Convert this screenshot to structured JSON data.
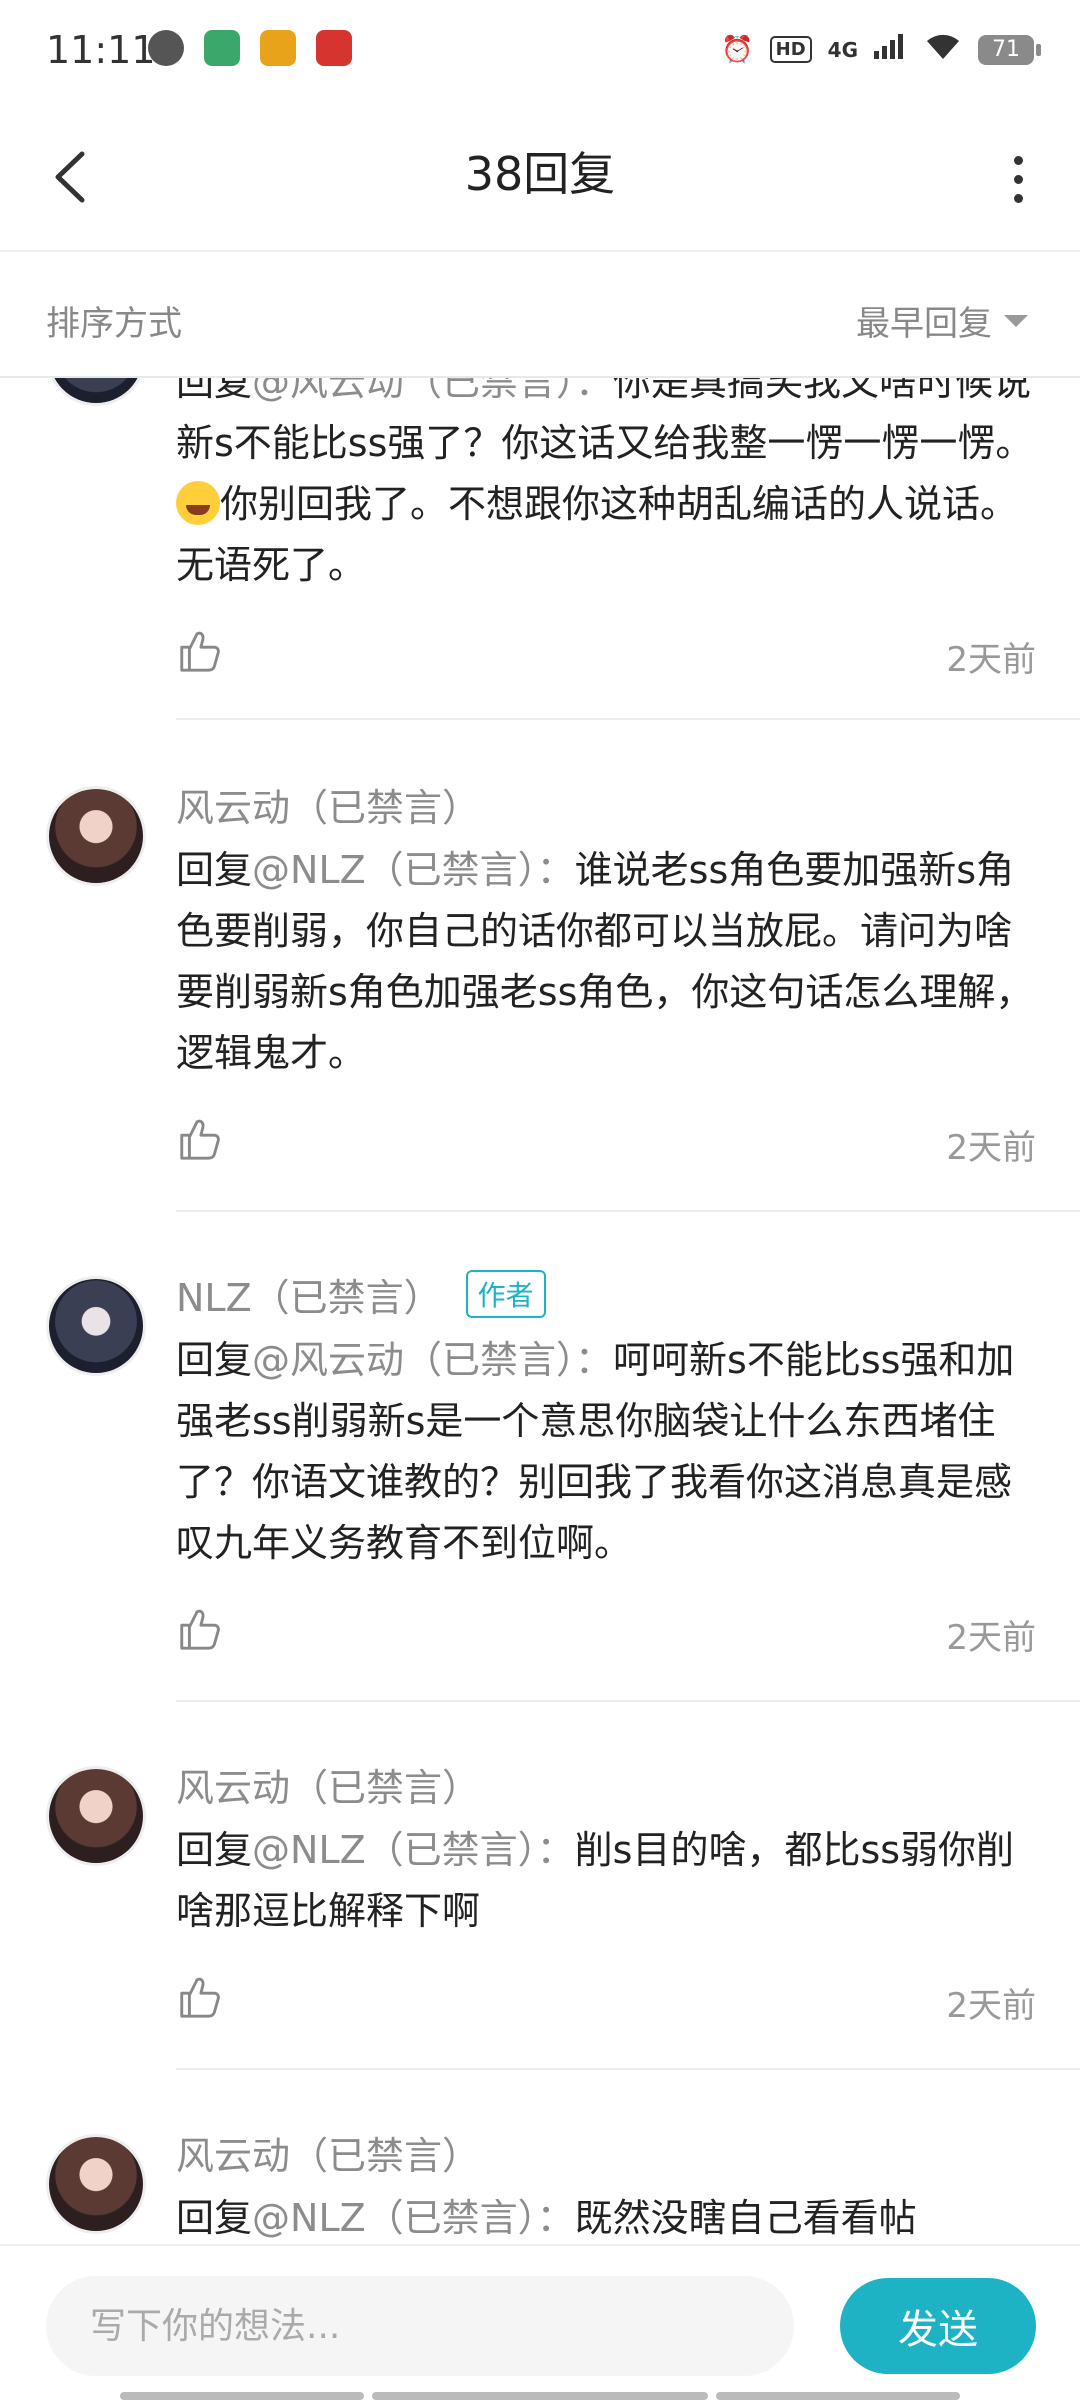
{
  "status_bar": {
    "time": "11:11",
    "network": "4G",
    "hd": "HD",
    "battery": "71"
  },
  "header": {
    "title": "38回复"
  },
  "sort": {
    "label": "排序方式",
    "value": "最早回复"
  },
  "replies": [
    {
      "name": "",
      "is_author": true,
      "at": "@风云动（已禁言）：",
      "prefix": "回复",
      "text": "你是真搞笑我又啥时候说新s不能比ss强了？你这话又给我整一愣一愣一愣。",
      "text_after_emoji": "你别回我了。不想跟你这种胡乱编话的人说话。无语死了。",
      "emoji": "laughing-tears",
      "time": "2天前"
    },
    {
      "name": "风云动（已禁言）",
      "is_author": false,
      "prefix": "回复",
      "at": "@NLZ（已禁言）：",
      "text": "谁说老ss角色要加强新s角色要削弱，你自己的话你都可以当放屁。请问为啥要削弱新s角色加强老ss角色，你这句话怎么理解，逻辑鬼才。",
      "time": "2天前"
    },
    {
      "name": "NLZ（已禁言）",
      "is_author": true,
      "author_tag": "作者",
      "prefix": "回复",
      "at": "@风云动（已禁言）：",
      "text": "呵呵新s不能比ss强和加强老ss削弱新s是一个意思你脑袋让什么东西堵住了？你语文谁教的？别回我了我看你这消息真是感叹九年义务教育不到位啊。",
      "time": "2天前"
    },
    {
      "name": "风云动（已禁言）",
      "is_author": false,
      "prefix": "回复",
      "at": "@NLZ（已禁言）：",
      "text": "削s目的啥，都比ss弱你削啥那逗比解释下啊",
      "time": "2天前"
    },
    {
      "name": "风云动（已禁言）",
      "is_author": false,
      "prefix": "回复",
      "at": "@NLZ（已禁言）：",
      "text": "既然没瞎自己看看帖",
      "time": ""
    }
  ],
  "composer": {
    "placeholder": "写下你的想法...",
    "send_label": "发送"
  },
  "colors": {
    "accent": "#1eb3c4",
    "muted": "#8c8c8c"
  }
}
